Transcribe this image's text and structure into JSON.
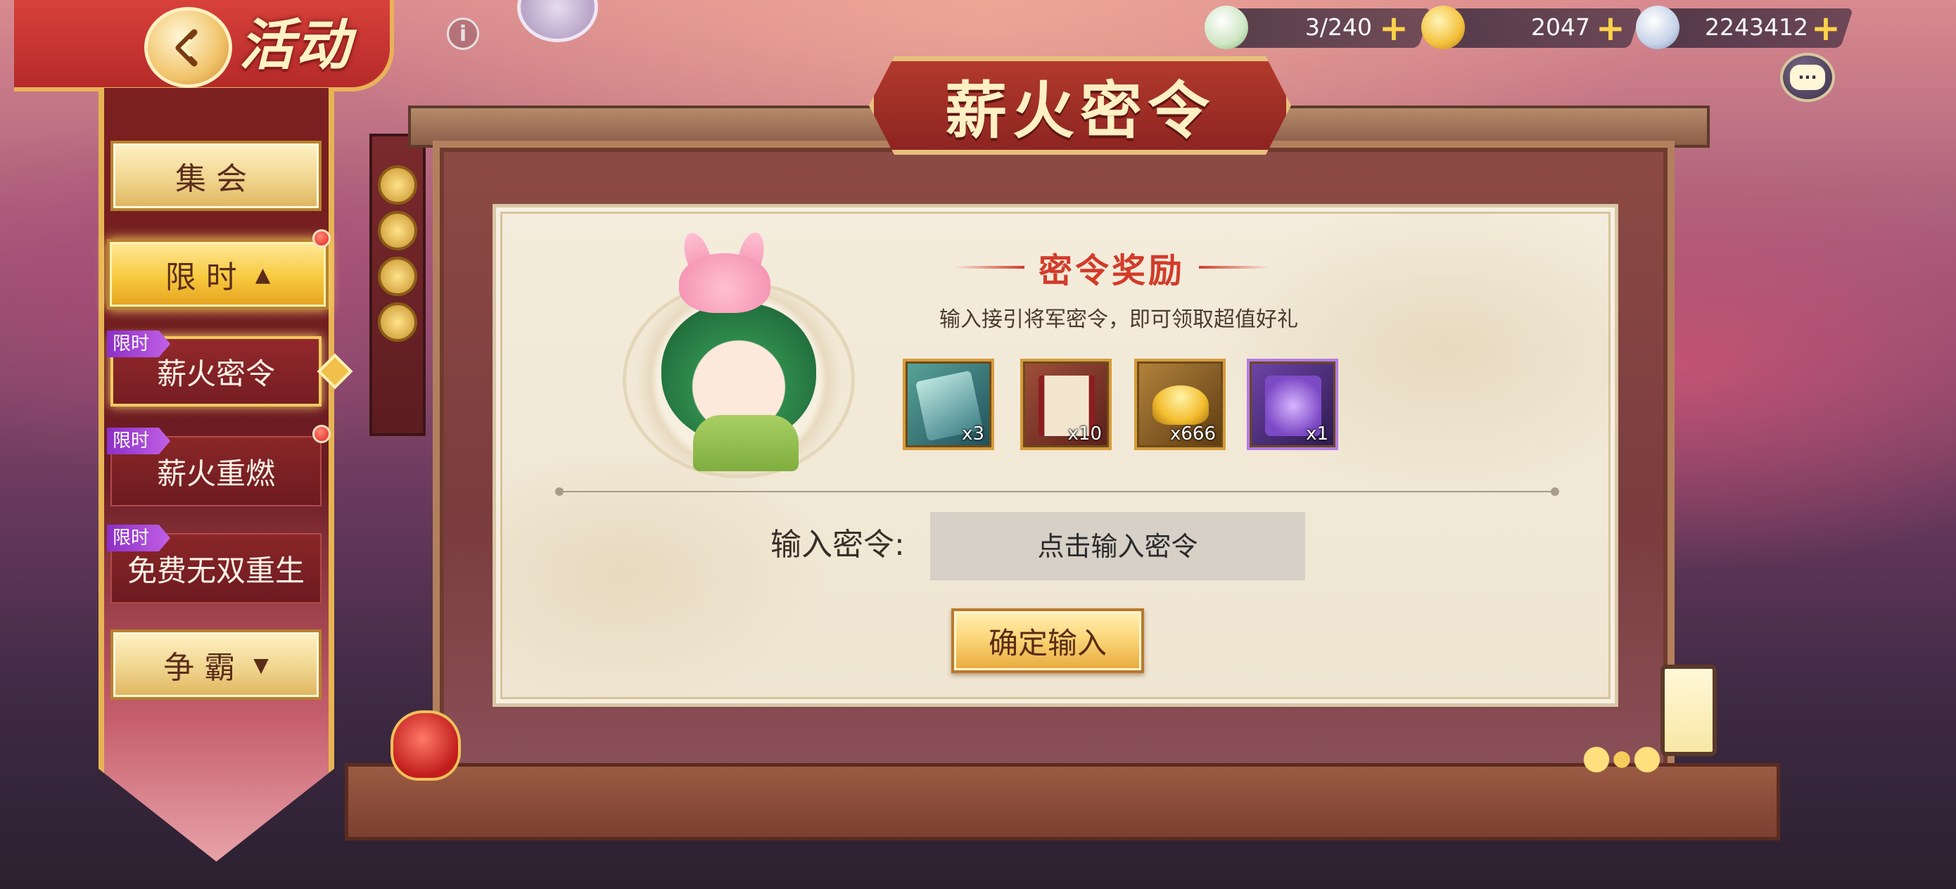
{
  "header": {
    "title": "活动",
    "info_glyph": "i"
  },
  "currencies": [
    {
      "icon": "bun-icon",
      "value": "3/240"
    },
    {
      "icon": "gold-ingot-icon",
      "value": "2047"
    },
    {
      "icon": "silver-coin-icon",
      "value": "2243412"
    }
  ],
  "plus_glyph": "+",
  "chat_glyph": "···",
  "sidebar": {
    "tabs": [
      {
        "label": "集会",
        "chevron": ""
      },
      {
        "label": "限时",
        "chevron": "▲"
      },
      {
        "label": "争霸",
        "chevron": "▼"
      }
    ],
    "sub_items": [
      {
        "badge": "限时",
        "label": "薪火密令"
      },
      {
        "badge": "限时",
        "label": "薪火重燃"
      },
      {
        "badge": "限时",
        "label": "免费无双重生"
      }
    ]
  },
  "main": {
    "title": "薪火密令",
    "reward_title": "密令奖励",
    "reward_desc": "输入接引将军密令，即可领取超值好礼",
    "rewards": [
      {
        "icon": "dragon-card-icon",
        "qty": "x3",
        "color": "#2f6f74"
      },
      {
        "icon": "scroll-icon",
        "qty": "x10",
        "color": "#7a2a24"
      },
      {
        "icon": "gold-ingot-icon",
        "qty": "x666",
        "color": "#8a5a1c"
      },
      {
        "icon": "purple-item-icon",
        "qty": "x1",
        "color": "#4b2d7a"
      }
    ],
    "code_label": "输入密令:",
    "code_placeholder": "点击输入密令",
    "confirm_label": "确定输入"
  },
  "colors": {
    "accent_red": "#d23b2a",
    "gold": "#e7b453",
    "badge_purple": "#8b2fc7"
  }
}
